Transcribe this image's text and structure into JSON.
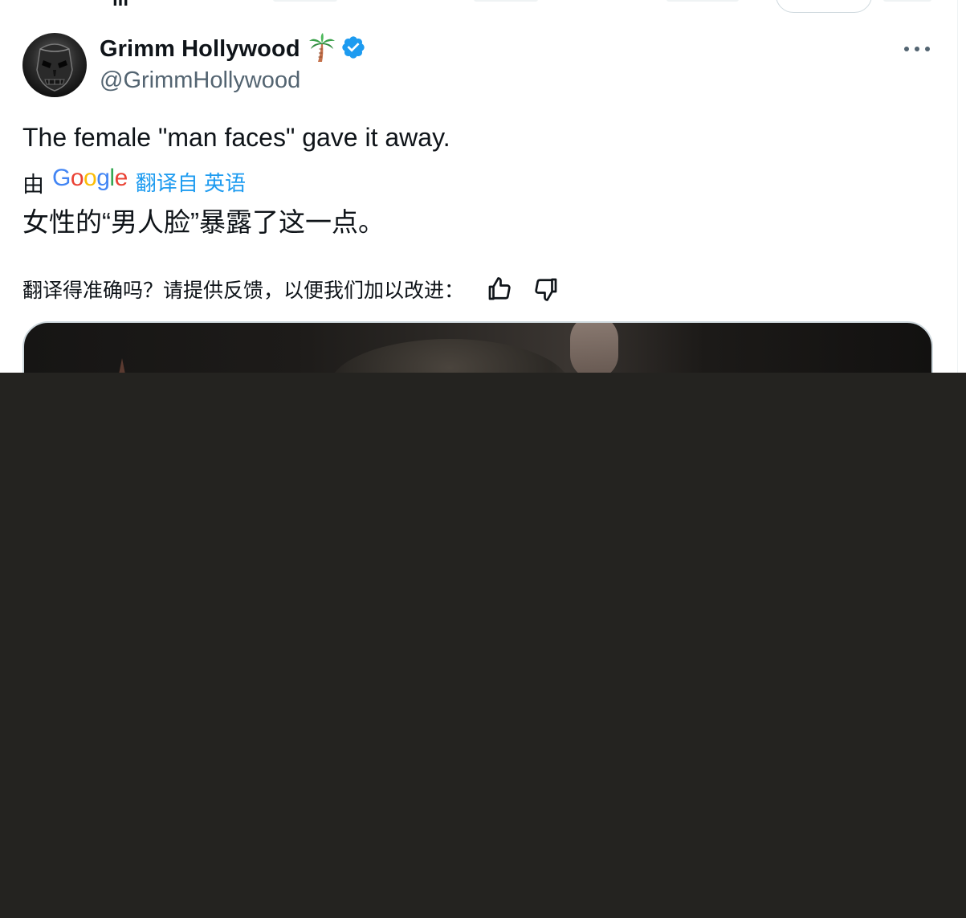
{
  "post": {
    "author": {
      "display_name": "Grimm Hollywood",
      "handle": "@GrimmHollywood",
      "avatar": "masked-face-avatar",
      "badges": [
        "palm-tree-icon",
        "verified-badge-icon"
      ]
    },
    "more_menu": "more-options-icon",
    "text": "The female \"man faces\" gave it away.",
    "translation": {
      "by_label": "由",
      "provider": "Google",
      "provider_letters": [
        "G",
        "o",
        "o",
        "g",
        "l",
        "e"
      ],
      "from_label": "翻译自 英语",
      "text": "女性的“男人脸”暴露了这一点。",
      "feedback_question": "翻译得准确吗？请提供反馈，以便我们加以改进：",
      "thumbs_up": "thumbs-up-icon",
      "thumbs_down": "thumbs-down-icon"
    },
    "media": {
      "kind": "image"
    }
  },
  "colors": {
    "text_primary": "#0f1419",
    "text_secondary": "#536471",
    "link": "#1d9bf0",
    "verified": "#1d9bf0",
    "overlay": "#242320",
    "border": "#cfd9de",
    "google_blue": "#4285f4",
    "google_red": "#ea4335",
    "google_yellow": "#fbbc05",
    "google_green": "#34a853"
  }
}
